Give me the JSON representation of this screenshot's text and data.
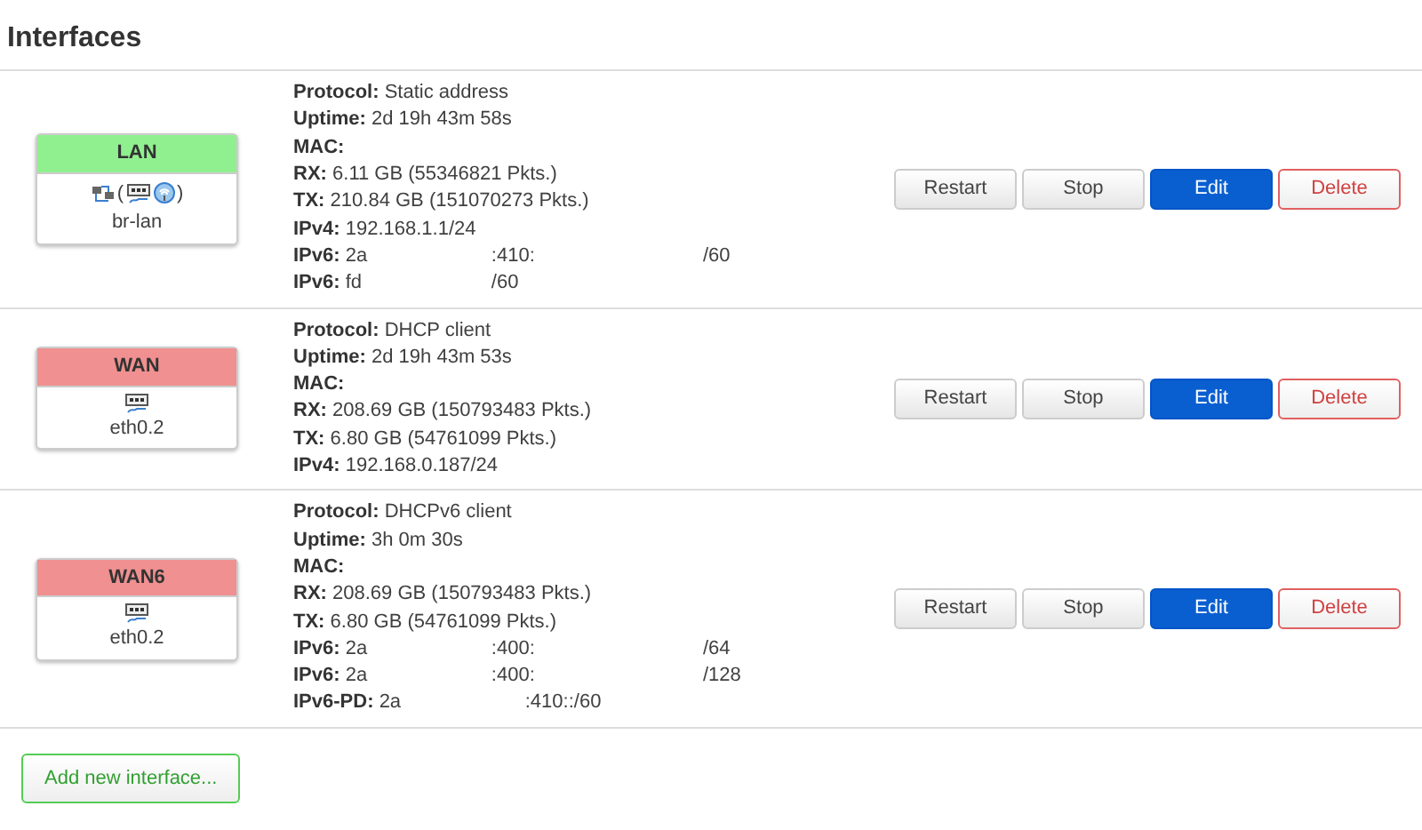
{
  "title": "Interfaces",
  "interfaces": [
    {
      "name": "LAN",
      "color": "#90f090",
      "device": "br-lan",
      "icons": [
        {
          "kind": "bridge"
        },
        {
          "kind": "text",
          "text": "("
        },
        {
          "kind": "port"
        },
        {
          "kind": "wifi"
        },
        {
          "kind": "text",
          "text": ")"
        }
      ],
      "details": [
        {
          "label": "Protocol:",
          "parts": [
            "Static address"
          ]
        },
        {
          "label": "Uptime:",
          "parts": [
            "2d 19h 43m 58s"
          ]
        },
        {
          "label": "MAC:"
        },
        {
          "label": "RX:",
          "parts": [
            "6.11 GB (55346821 Pkts.)"
          ]
        },
        {
          "label": "TX:",
          "parts": [
            "210.84 GB (151070273 Pkts.)"
          ]
        },
        {
          "label": "IPv4:",
          "parts": [
            "192.168.1.1/24"
          ]
        },
        {
          "label": "IPv6:",
          "parts": [
            "2a",
            ":410:",
            "/60"
          ]
        },
        {
          "label": "IPv6:",
          "parts": [
            "fd",
            "/60"
          ]
        }
      ],
      "buttons": [
        "Restart",
        "Stop",
        "Edit",
        "Delete"
      ]
    },
    {
      "name": "WAN",
      "color": "#f09090",
      "device": "eth0.2",
      "icons": [
        {
          "kind": "port"
        }
      ],
      "details": [
        {
          "label": "Protocol:",
          "parts": [
            "DHCP client"
          ]
        },
        {
          "label": "Uptime:",
          "parts": [
            "2d 19h 43m 53s"
          ]
        },
        {
          "label": "MAC:"
        },
        {
          "label": "RX:",
          "parts": [
            "208.69 GB (150793483 Pkts.)"
          ]
        },
        {
          "label": "TX:",
          "parts": [
            "6.80 GB (54761099 Pkts.)"
          ]
        },
        {
          "label": "IPv4:",
          "parts": [
            "192.168.0.187/24"
          ]
        }
      ],
      "buttons": [
        "Restart",
        "Stop",
        "Edit",
        "Delete"
      ]
    },
    {
      "name": "WAN6",
      "color": "#f09090",
      "device": "eth0.2",
      "icons": [
        {
          "kind": "port"
        }
      ],
      "details": [
        {
          "label": "Protocol:",
          "parts": [
            "DHCPv6 client"
          ]
        },
        {
          "label": "Uptime:",
          "parts": [
            "3h 0m 30s"
          ]
        },
        {
          "label": "MAC:"
        },
        {
          "label": "RX:",
          "parts": [
            "208.69 GB (150793483 Pkts.)"
          ]
        },
        {
          "label": "TX:",
          "parts": [
            "6.80 GB (54761099 Pkts.)"
          ]
        },
        {
          "label": "IPv6:",
          "parts": [
            "2a",
            ":400:",
            "/64"
          ]
        },
        {
          "label": "IPv6:",
          "parts": [
            "2a",
            ":400:",
            "/128"
          ]
        },
        {
          "label": "IPv6-PD:",
          "parts": [
            "2a",
            ":410::/60"
          ]
        }
      ],
      "buttons": [
        "Restart",
        "Stop",
        "Edit",
        "Delete"
      ]
    }
  ],
  "add_button": "Add new interface..."
}
